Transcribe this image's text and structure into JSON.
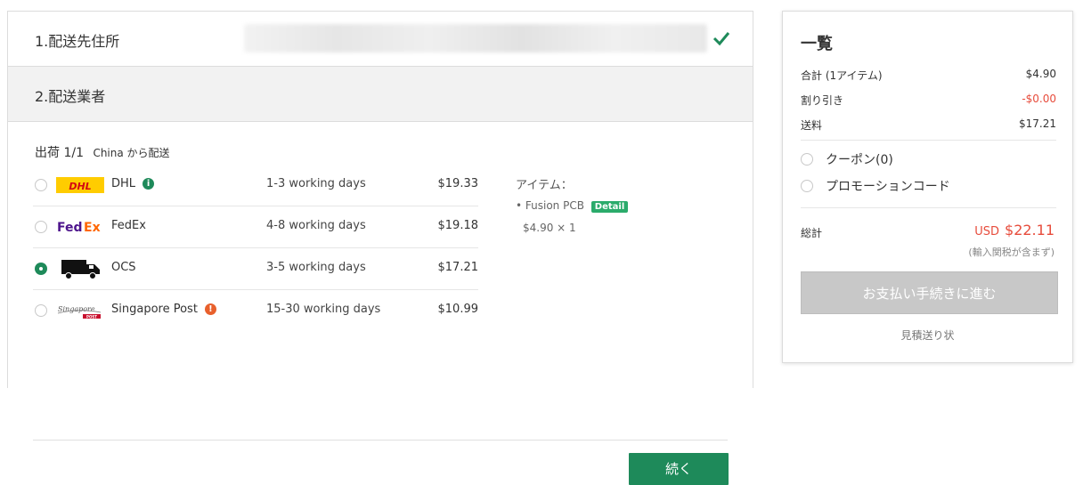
{
  "steps": {
    "step1_title": "1.配送先住所",
    "step2_title": "2.配送業者"
  },
  "shipment": {
    "heading": "出荷 1/1",
    "from": "China から配送",
    "carriers": [
      {
        "name": "DHL",
        "days": "1-3 working days",
        "price": "$19.33",
        "selected": false,
        "info_icon": "info-icon",
        "info_color": "#1e8a5a"
      },
      {
        "name": "FedEx",
        "days": "4-8 working days",
        "price": "$19.18",
        "selected": false
      },
      {
        "name": "OCS",
        "days": "3-5 working days",
        "price": "$17.21",
        "selected": true
      },
      {
        "name": "Singapore Post",
        "days": "15-30 working days",
        "price": "$10.99",
        "selected": false,
        "info_icon": "warning-icon",
        "info_color": "#e8602c"
      }
    ],
    "items_title": "アイテム：",
    "item_name": "Fusion PCB",
    "detail_badge": "Detail",
    "item_qty": "$4.90 × 1",
    "continue_label": "続く"
  },
  "summary": {
    "title": "一覧",
    "subtotal_label": "合計 (1アイテム)",
    "subtotal_value": "$4.90",
    "discount_label": "割り引き",
    "discount_value": "-$0.00",
    "shipping_label": "送料",
    "shipping_value": "$17.21",
    "coupon_label": "クーポン(0)",
    "promo_label": "プロモーションコード",
    "total_label": "総計",
    "total_currency": "USD",
    "total_amount": "$22.11",
    "tax_note": "(輸入関税が含まず)",
    "pay_label": "お支払い手続きに進む",
    "quote_label": "見積送り状"
  },
  "colors": {
    "accent": "#1e8a5a",
    "price_red": "#e74c3c",
    "disabled_button": "#c8c8c8"
  }
}
